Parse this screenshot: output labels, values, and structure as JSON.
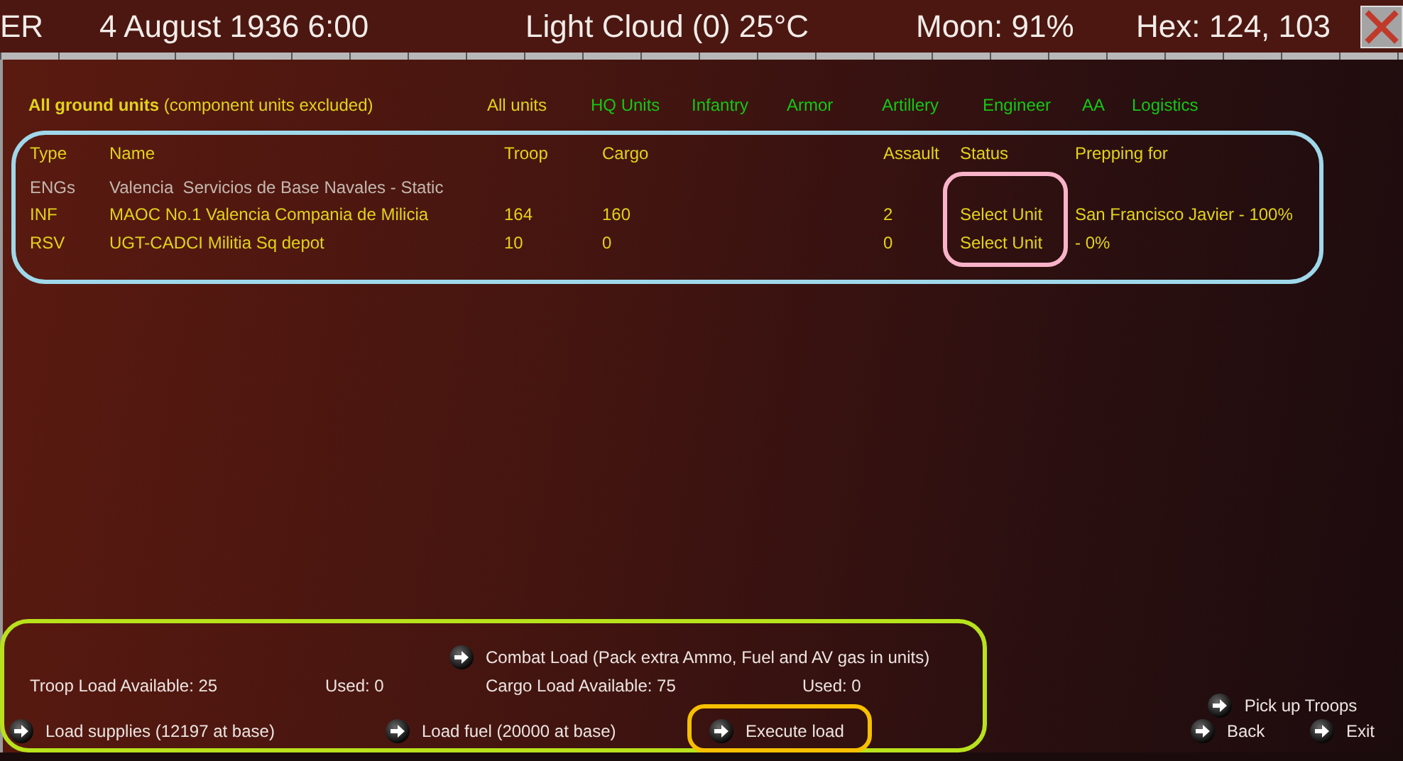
{
  "top_bar": {
    "items": [
      "ER",
      "4 August 1936 6:00",
      "Light Cloud (0) 25°C",
      "Moon: 91%",
      "Hex: 124, 103"
    ]
  },
  "filter": {
    "title": "**All ground units** (component units excluded)",
    "options": [
      {
        "label": "All units",
        "selected": true
      },
      {
        "label": "HQ Units",
        "selected": false
      },
      {
        "label": "Infantry",
        "selected": false
      },
      {
        "label": "Armor",
        "selected": false
      },
      {
        "label": "Artillery",
        "selected": false
      },
      {
        "label": "Engineer",
        "selected": false
      },
      {
        "label": "AA",
        "selected": false
      },
      {
        "label": "Logistics",
        "selected": false
      }
    ]
  },
  "table": {
    "columns": [
      "Type",
      "Name",
      "Troop",
      "Cargo",
      "Assault",
      "Status",
      "Prepping for"
    ],
    "rows": [
      {
        "type": "ENGs",
        "name": "Valencia  Servicios de Base Navales - Static",
        "disabled": true
      },
      {
        "type": "INF",
        "name": "MAOC No.1 Valencia Compania de Milicia",
        "troop": "164",
        "cargo": "160",
        "assault": "2",
        "status": "Select Unit",
        "prepping_for": "San Francisco Javier - 100%",
        "disabled": false
      },
      {
        "type": "RSV",
        "name": "UGT-CADCI Militia Sq depot",
        "troop": "10",
        "cargo": "0",
        "assault": "0",
        "status": "Select Unit",
        "prepping_for": "- 0%",
        "disabled": false
      }
    ]
  },
  "load": {
    "combat_load": "Combat Load (Pack extra Ammo, Fuel and AV gas in units)",
    "troop_load": "Troop Load Available: 25",
    "troop_used": "Used: 0",
    "cargo_load": "Cargo Load Available: 75",
    "cargo_used": "Used: 0",
    "actions": [
      "Load supplies (12197 at base)",
      "Load fuel (20000 at base)",
      "Execute load"
    ]
  },
  "nav": [
    "Pick up Troops",
    "Back",
    "Exit"
  ],
  "annotations": [
    {
      "kind": "ellipse",
      "color": "#9fd8ea"
    },
    {
      "kind": "ellipse",
      "color": "#f9b3c9"
    },
    {
      "kind": "ellipse",
      "color": "#b8e21c"
    },
    {
      "kind": "ellipse",
      "color": "#f6c000"
    }
  ]
}
